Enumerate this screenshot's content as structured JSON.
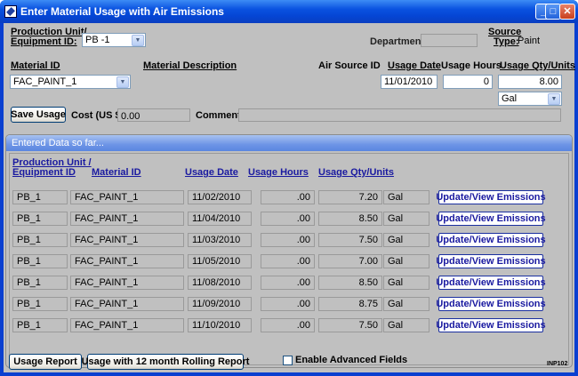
{
  "window": {
    "title": "Enter Material Usage with Air Emissions",
    "controls": {
      "minimize": "_",
      "maximize": "□",
      "close": "✕"
    }
  },
  "form": {
    "production_unit_label_1": "Production Unit/",
    "production_unit_label_2": "Equipment ID:",
    "production_unit_value": "PB -1",
    "department_label": "Department:",
    "department_value": "",
    "source_type_label_1": "Source",
    "source_type_label_2": "Type:",
    "source_type_value": "Paint",
    "material_id_label": "Material ID",
    "material_description_label": "Material Description",
    "air_source_id_label": "Air Source ID",
    "usage_date_label": "Usage Date",
    "usage_hours_label": "Usage Hours",
    "usage_qty_label": "Usage Qty/Units",
    "material_id_value": "FAC_PAINT_1",
    "usage_date_value": "11/01/2010",
    "usage_hours_value": "0",
    "usage_qty_value": "8.00",
    "units_value": "Gal",
    "save_button": "Save Usage",
    "cost_label": "Cost (US $):",
    "cost_value": "0.00",
    "comment_label": "Comment:",
    "comment_value": ""
  },
  "entered": {
    "panel_title": "Entered Data so far...",
    "headers": {
      "unit_1": "Production Unit /",
      "unit_2": "Equipment ID",
      "material": "Material ID",
      "date": "Usage Date",
      "hours": "Usage Hours",
      "qty": "Usage Qty/Units"
    },
    "update_label": "Update/View Emissions",
    "rows": [
      {
        "unit": "PB_1",
        "material": "FAC_PAINT_1",
        "date": "11/02/2010",
        "hours": ".00",
        "qty": "7.20",
        "units": "Gal"
      },
      {
        "unit": "PB_1",
        "material": "FAC_PAINT_1",
        "date": "11/04/2010",
        "hours": ".00",
        "qty": "8.50",
        "units": "Gal"
      },
      {
        "unit": "PB_1",
        "material": "FAC_PAINT_1",
        "date": "11/03/2010",
        "hours": ".00",
        "qty": "7.50",
        "units": "Gal"
      },
      {
        "unit": "PB_1",
        "material": "FAC_PAINT_1",
        "date": "11/05/2010",
        "hours": ".00",
        "qty": "7.00",
        "units": "Gal"
      },
      {
        "unit": "PB_1",
        "material": "FAC_PAINT_1",
        "date": "11/08/2010",
        "hours": ".00",
        "qty": "8.50",
        "units": "Gal"
      },
      {
        "unit": "PB_1",
        "material": "FAC_PAINT_1",
        "date": "11/09/2010",
        "hours": ".00",
        "qty": "8.75",
        "units": "Gal"
      },
      {
        "unit": "PB_1",
        "material": "FAC_PAINT_1",
        "date": "11/10/2010",
        "hours": ".00",
        "qty": "7.50",
        "units": "Gal"
      }
    ]
  },
  "footer": {
    "usage_report_button": "Usage Report",
    "rolling_report_button": "Usage with 12 month Rolling Report",
    "advanced_fields_label": "Enable Advanced Fields",
    "advanced_fields_checked": false,
    "screen_code": "INP102"
  }
}
